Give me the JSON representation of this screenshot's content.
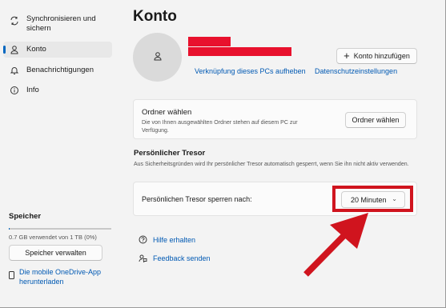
{
  "sidebar": {
    "items": [
      {
        "label": "Synchronisieren und sichern",
        "icon": "sync-icon"
      },
      {
        "label": "Konto",
        "icon": "person-icon"
      },
      {
        "label": "Benachrichtigungen",
        "icon": "bell-icon"
      },
      {
        "label": "Info",
        "icon": "info-icon"
      }
    ],
    "storage": {
      "title": "Speicher",
      "used_fraction": 0.007,
      "usage_text": "0.7 GB verwendet von 1 TB (0%)",
      "manage_label": "Speicher verwalten"
    },
    "mobile_link": "Die mobile OneDrive-App herunterladen"
  },
  "main": {
    "title": "Konto",
    "add_account_label": "Konto hinzufügen",
    "unlink_label": "Verknüpfung dieses PCs aufheben",
    "privacy_label": "Datenschutzeinstellungen",
    "folders": {
      "title": "Ordner wählen",
      "description": "Die von Ihnen ausgewählten Ordner stehen auf diesem PC zur Verfügung.",
      "button_label": "Ordner wählen"
    },
    "vault": {
      "section_title": "Persönlicher Tresor",
      "section_description": "Aus Sicherheitsgründen wird Ihr persönlicher Tresor automatisch gesperrt, wenn Sie ihn nicht aktiv verwenden.",
      "lock_label": "Persönlichen Tresor sperren nach:",
      "lock_value": "20 Minuten"
    },
    "help_label": "Hilfe erhalten",
    "feedback_label": "Feedback senden"
  },
  "colors": {
    "accent": "#0067c0",
    "highlight": "#d0141e",
    "redaction": "#e8112d"
  }
}
